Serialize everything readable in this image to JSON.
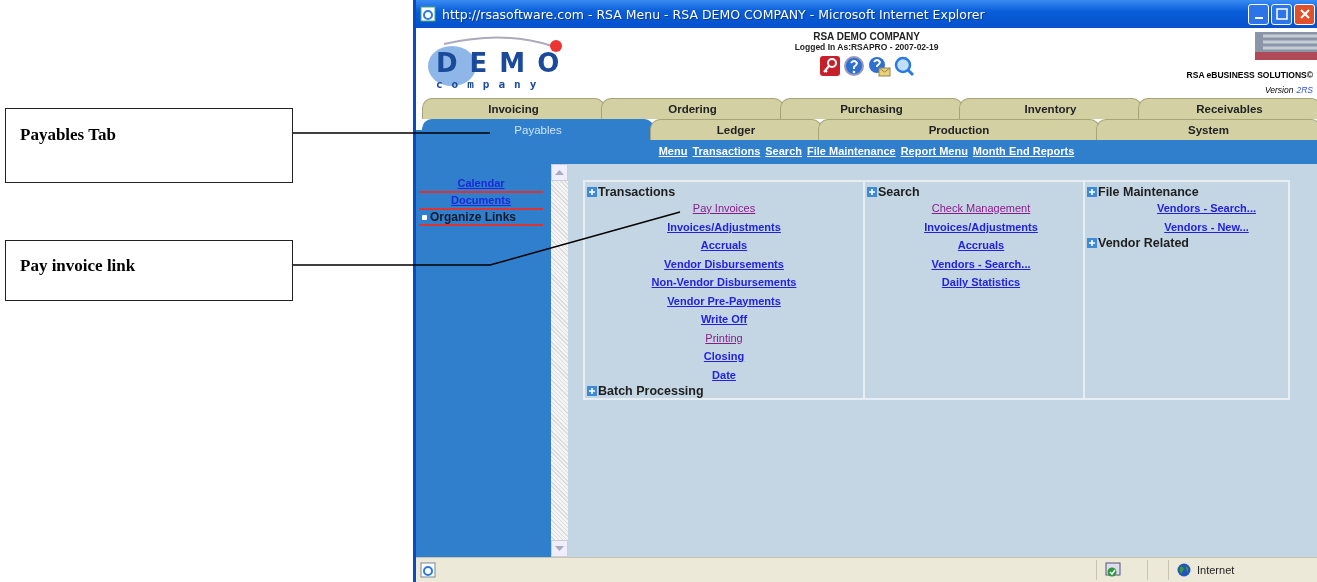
{
  "annotations": [
    {
      "label": "Payables Tab"
    },
    {
      "label": "Pay invoice link"
    }
  ],
  "window": {
    "title": "http://rsasoftware.com - RSA Menu - RSA DEMO COMPANY - Microsoft Internet Explorer"
  },
  "header": {
    "logo_word": "DEMO",
    "logo_sub": "company",
    "company": "RSA DEMO COMPANY",
    "logged_in": "Logged In As:RSAPRO - 2007-02-19",
    "brand": "RSA eBUSINESS SOLUTIONS©",
    "version_label": "Version",
    "version": "2RS"
  },
  "tabs_row_1": [
    {
      "label": "Invoicing",
      "selected": false
    },
    {
      "label": "Ordering",
      "selected": false
    },
    {
      "label": "Purchasing",
      "selected": false
    },
    {
      "label": "Inventory",
      "selected": false
    },
    {
      "label": "Receivables",
      "selected": false
    }
  ],
  "tabs_row_2": [
    {
      "label": "Payables",
      "selected": true
    },
    {
      "label": "Ledger",
      "selected": false
    },
    {
      "label": "Production",
      "selected": false
    },
    {
      "label": "System",
      "selected": false
    }
  ],
  "nav_links": [
    "Menu",
    "Transactions",
    "Search",
    "File Maintenance",
    "Report Menu",
    "Month End Reports"
  ],
  "sidebar": {
    "links": [
      "Calendar",
      "Documents"
    ],
    "group": "Organize Links"
  },
  "columns": [
    {
      "groups": [
        {
          "title": "Transactions",
          "links": [
            {
              "label": "Pay Invoices",
              "visited": true
            },
            {
              "label": "Invoices/Adjustments",
              "visited": false
            },
            {
              "label": "Accruals",
              "visited": false
            },
            {
              "label": "Vendor Disbursements",
              "visited": false
            },
            {
              "label": "Non-Vendor Disbursements",
              "visited": false
            },
            {
              "label": "Vendor Pre-Payments",
              "visited": false
            },
            {
              "label": "Write Off",
              "visited": false
            },
            {
              "label": "Printing",
              "visited": true
            },
            {
              "label": "Closing",
              "visited": false
            },
            {
              "label": "Date",
              "visited": false
            }
          ]
        },
        {
          "title": "Batch Processing"
        }
      ]
    },
    {
      "groups": [
        {
          "title": "Search",
          "links": [
            {
              "label": "Check Management",
              "visited": true
            },
            {
              "label": "Invoices/Adjustments",
              "visited": false
            },
            {
              "label": "Accruals",
              "visited": false
            },
            {
              "label": "Vendors - Search...",
              "visited": false
            },
            {
              "label": "Daily Statistics",
              "visited": false
            }
          ]
        }
      ]
    },
    {
      "groups": [
        {
          "title": "File Maintenance",
          "links": [
            {
              "label": "Vendors - Search...",
              "visited": false
            },
            {
              "label": "Vendors - New...",
              "visited": false
            }
          ]
        },
        {
          "title": "Vendor Related"
        }
      ]
    }
  ],
  "status_bar": {
    "zone": "Internet"
  }
}
